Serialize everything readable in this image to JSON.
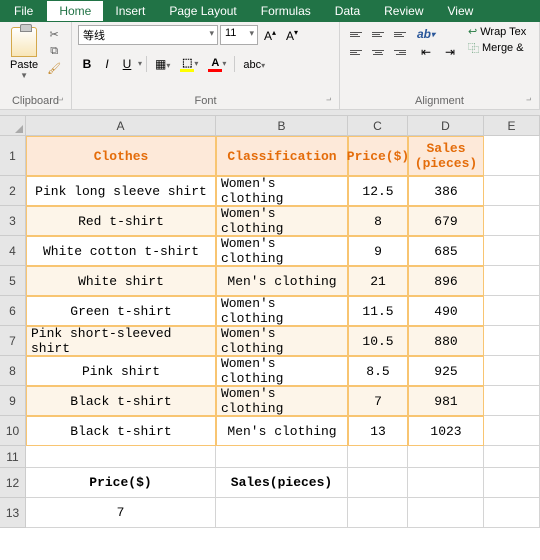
{
  "app": {
    "file_label": "File"
  },
  "tabs": [
    "Home",
    "Insert",
    "Page Layout",
    "Formulas",
    "Data",
    "Review",
    "View"
  ],
  "active_tab": "Home",
  "ribbon": {
    "clipboard": {
      "paste": "Paste",
      "label": "Clipboard"
    },
    "font": {
      "name": "等线",
      "size": "11",
      "bold": "B",
      "italic": "I",
      "underline": "U",
      "label": "Font"
    },
    "alignment": {
      "wrap": "Wrap Tex",
      "merge": "Merge &",
      "label": "Alignment"
    }
  },
  "columns": [
    "A",
    "B",
    "C",
    "D",
    "E"
  ],
  "row_heights": {
    "header": 40,
    "data": 30,
    "small": 22
  },
  "table": {
    "headers": [
      "Clothes",
      "Classification",
      "Price($)",
      "Sales\n(pieces)"
    ],
    "rows": [
      [
        "Pink long sleeve shirt",
        "Women's clothing",
        "12.5",
        "386"
      ],
      [
        "Red t-shirt",
        "Women's clothing",
        "8",
        "679"
      ],
      [
        "White cotton t-shirt",
        "Women's clothing",
        "9",
        "685"
      ],
      [
        "White shirt",
        "Men's clothing",
        "21",
        "896"
      ],
      [
        "Green t-shirt",
        "Women's clothing",
        "11.5",
        "490"
      ],
      [
        "Pink short-sleeved shirt",
        "Women's clothing",
        "10.5",
        "880"
      ],
      [
        "Pink shirt",
        "Women's clothing",
        "8.5",
        "925"
      ],
      [
        "Black t-shirt",
        "Women's clothing",
        "7",
        "981"
      ],
      [
        "Black t-shirt",
        "Men's clothing",
        "13",
        "1023"
      ]
    ]
  },
  "lower": {
    "r12": [
      "Price($)",
      "Sales(pieces)"
    ],
    "r13": "7"
  },
  "chart_data": {
    "type": "table",
    "title": "",
    "columns": [
      "Clothes",
      "Classification",
      "Price($)",
      "Sales (pieces)"
    ],
    "rows": [
      {
        "Clothes": "Pink long sleeve shirt",
        "Classification": "Women's clothing",
        "Price($)": 12.5,
        "Sales (pieces)": 386
      },
      {
        "Clothes": "Red t-shirt",
        "Classification": "Women's clothing",
        "Price($)": 8,
        "Sales (pieces)": 679
      },
      {
        "Clothes": "White cotton t-shirt",
        "Classification": "Women's clothing",
        "Price($)": 9,
        "Sales (pieces)": 685
      },
      {
        "Clothes": "White shirt",
        "Classification": "Men's clothing",
        "Price($)": 21,
        "Sales (pieces)": 896
      },
      {
        "Clothes": "Green t-shirt",
        "Classification": "Women's clothing",
        "Price($)": 11.5,
        "Sales (pieces)": 490
      },
      {
        "Clothes": "Pink short-sleeved shirt",
        "Classification": "Women's clothing",
        "Price($)": 10.5,
        "Sales (pieces)": 880
      },
      {
        "Clothes": "Pink shirt",
        "Classification": "Women's clothing",
        "Price($)": 8.5,
        "Sales (pieces)": 925
      },
      {
        "Clothes": "Black t-shirt",
        "Classification": "Women's clothing",
        "Price($)": 7,
        "Sales (pieces)": 981
      },
      {
        "Clothes": "Black t-shirt",
        "Classification": "Men's clothing",
        "Price($)": 13,
        "Sales (pieces)": 1023
      }
    ]
  }
}
